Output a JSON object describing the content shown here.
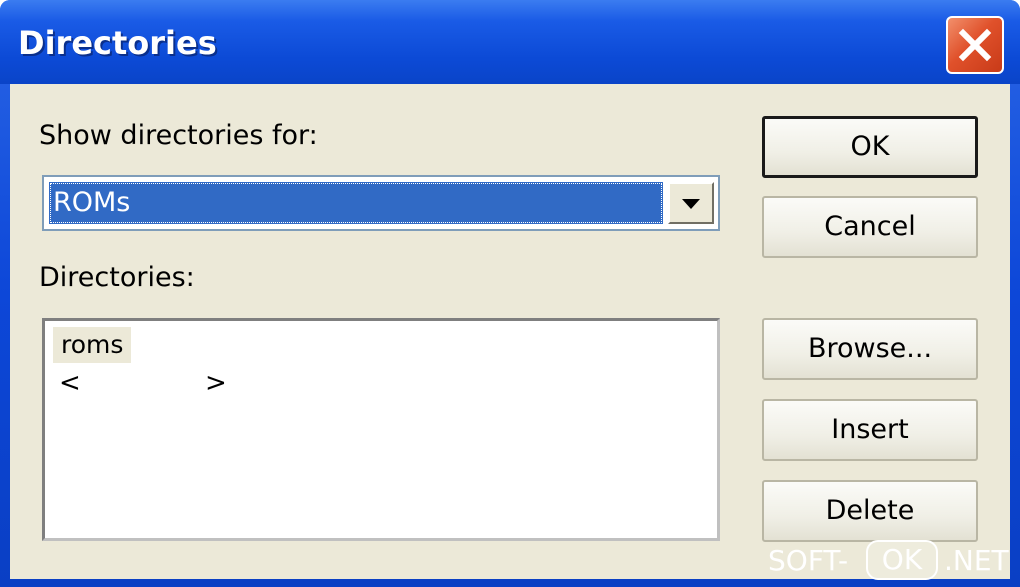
{
  "window": {
    "title": "Directories",
    "close_icon": "close-icon"
  },
  "form": {
    "show_label": "Show directories for:",
    "combo_value": "ROMs",
    "directories_label": "Directories:"
  },
  "list": {
    "items": [
      "roms"
    ],
    "new_item_left": "<",
    "new_item_right": ">"
  },
  "buttons": {
    "ok": "OK",
    "cancel": "Cancel",
    "browse": "Browse...",
    "insert": "Insert",
    "delete": "Delete"
  },
  "watermark": {
    "part1": "SOFT-",
    "part2": "OK",
    "part3": ".NET"
  },
  "colors": {
    "titlebar": "#0c4ad6",
    "client_bg": "#ece9d8",
    "selection": "#316ac5",
    "close_button": "#e0512b"
  }
}
